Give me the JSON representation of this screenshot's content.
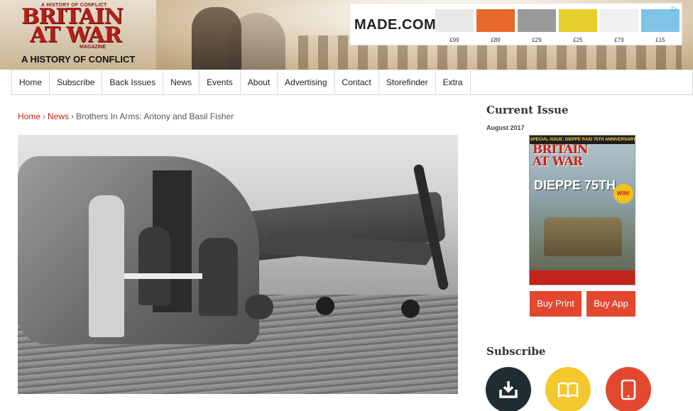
{
  "header": {
    "logo_top": "A HISTORY OF CONFLICT",
    "logo_word1": "BRITAIN",
    "logo_word2": "AT WAR",
    "logo_magazine": "MAGAZINE",
    "tagline": "A HISTORY OF CONFLICT"
  },
  "ad": {
    "brand": "MADE.COM",
    "items": [
      {
        "price": "£99",
        "color": "#e8e8e8"
      },
      {
        "price": "£89",
        "color": "#e8692a"
      },
      {
        "price": "£29",
        "color": "#9a9a9a"
      },
      {
        "price": "£25",
        "color": "#e6cf2a"
      },
      {
        "price": "£79",
        "color": "#f0f0f0"
      },
      {
        "price": "£15",
        "color": "#7fc4e6"
      }
    ],
    "adchoice_icon": "adchoices-icon"
  },
  "nav": {
    "tabs": [
      "Home",
      "Subscribe",
      "Back Issues",
      "News",
      "Events",
      "About",
      "Advertising",
      "Contact",
      "Storefinder",
      "Extra"
    ]
  },
  "breadcrumb": {
    "home": "Home",
    "news": "News",
    "current": "Brothers In Arms: Antony and Basil Fisher",
    "separator": "›"
  },
  "sidebar": {
    "current_issue_title": "Current Issue",
    "issue_date": "August 2017",
    "cover": {
      "special": "SPECIAL ISSUE: DIEPPE RAID 75TH ANNIVERSARY",
      "title_line1": "BRITAIN",
      "title_line2": "AT WAR",
      "headline": "DIEPPE 75TH",
      "win": "WIN!"
    },
    "buy_print": "Buy Print",
    "buy_app": "Buy App",
    "subscribe_title": "Subscribe",
    "subscribe_icons": [
      {
        "name": "download-icon",
        "color": "#1f2d33"
      },
      {
        "name": "book-icon",
        "color": "#f3c82e"
      },
      {
        "name": "tablet-icon",
        "color": "#e2472f"
      }
    ]
  },
  "colors": {
    "accent_red": "#c3261a",
    "button_red": "#e2472f"
  }
}
